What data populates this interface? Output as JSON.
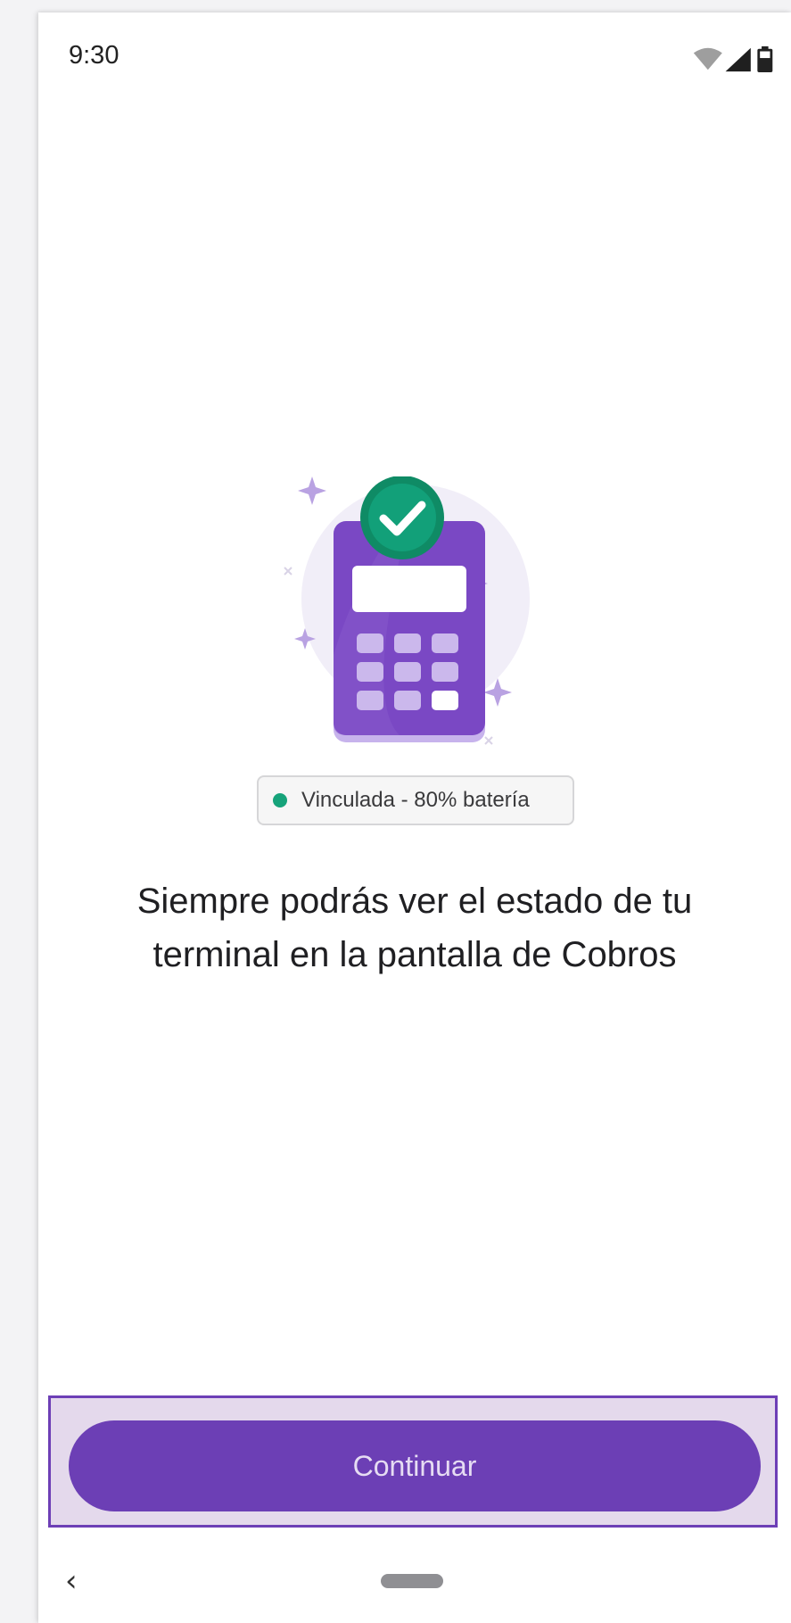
{
  "status_bar": {
    "time": "9:30",
    "icons": [
      "wifi-icon",
      "cellular-signal-icon",
      "battery-icon"
    ]
  },
  "illustration": {
    "name": "payment-terminal-linked-illustration",
    "accent_color": "#6c3fb5",
    "check_color": "#12916b"
  },
  "terminal_status": {
    "label": "Vinculada - 80% batería",
    "indicator_color": "#16a37a"
  },
  "headline": "Siempre podrás ver el estado de tu terminal en la pantalla de Cobros",
  "continue_button": {
    "label": "Continuar",
    "color": "#6c3fb5"
  },
  "navigation": {
    "back_icon": "chevron-left-icon",
    "home_icon": "home-pill-icon"
  }
}
